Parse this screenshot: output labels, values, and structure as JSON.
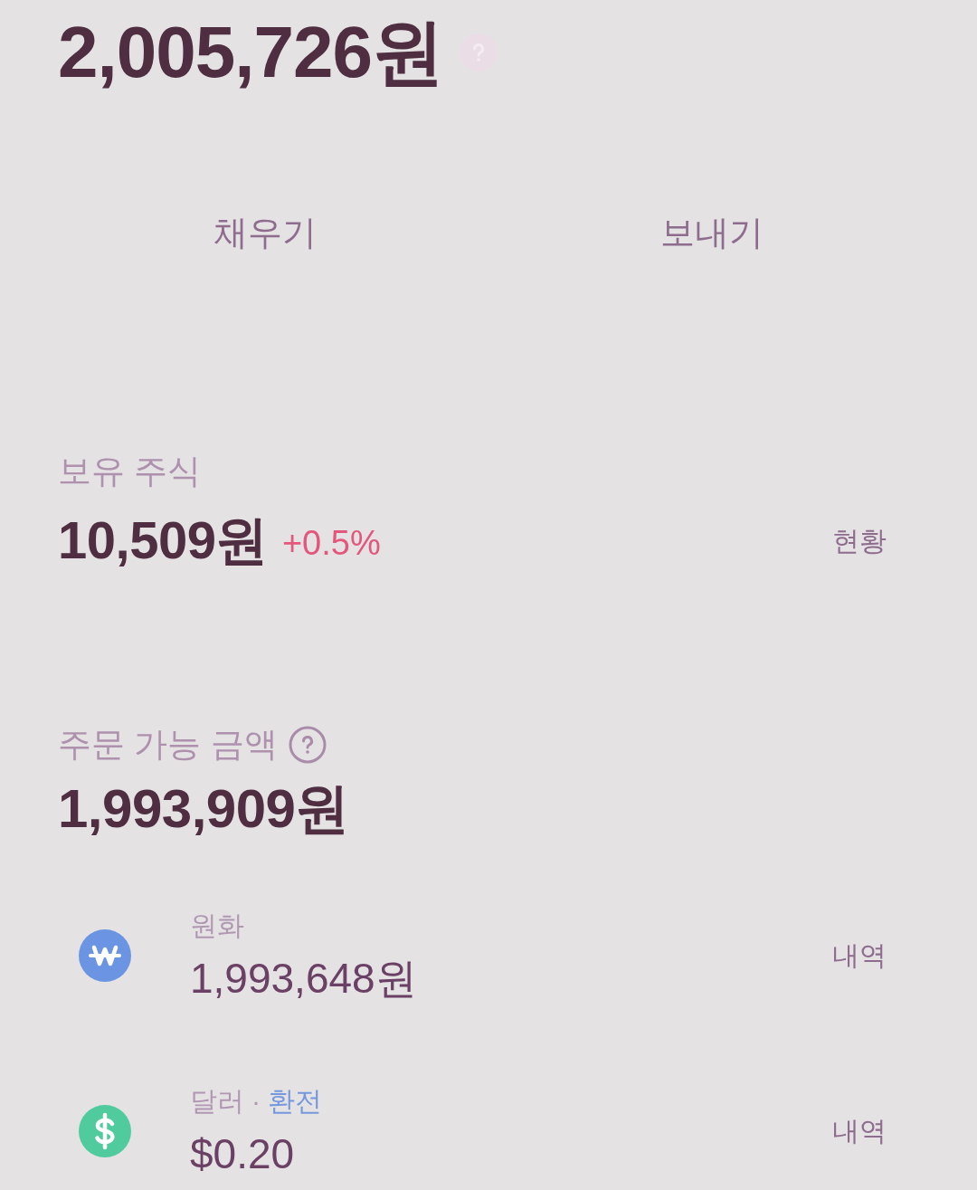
{
  "total": {
    "amount": "2,005,726원"
  },
  "actions": [
    {
      "label": "채우기"
    },
    {
      "label": "보내기"
    }
  ],
  "holdings": {
    "title": "보유 주식",
    "amount": "10,509원",
    "change": "+0.5%",
    "link": "현황"
  },
  "orderable": {
    "title": "주문 가능 금액",
    "amount": "1,993,909원"
  },
  "accounts": [
    {
      "kind": "won",
      "label": "원화",
      "amount": "1,993,648원",
      "link": "내역"
    },
    {
      "kind": "dollar",
      "label": "달러",
      "separator": "·",
      "exchange": "환전",
      "amount": "$0.20",
      "link": "내역"
    }
  ]
}
